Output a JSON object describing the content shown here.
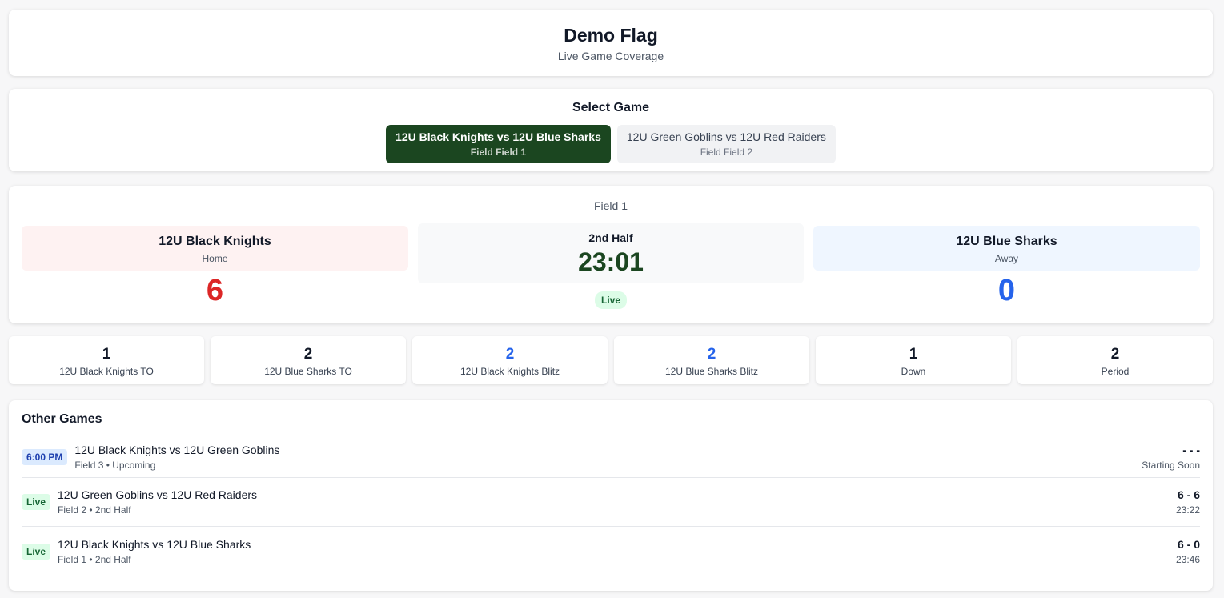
{
  "header": {
    "title": "Demo Flag",
    "subtitle": "Live Game Coverage"
  },
  "select": {
    "title": "Select Game",
    "games": [
      {
        "label": "12U Black Knights vs 12U Blue Sharks",
        "field": "Field Field 1"
      },
      {
        "label": "12U Green Goblins vs 12U Red Raiders",
        "field": "Field Field 2"
      }
    ]
  },
  "score": {
    "field": "Field 1",
    "home": {
      "name": "12U Black Knights",
      "role": "Home",
      "score": "6"
    },
    "away": {
      "name": "12U Blue Sharks",
      "role": "Away",
      "score": "0"
    },
    "period": "2nd Half",
    "clock": "23:01",
    "status": "Live"
  },
  "stats": [
    {
      "value": "1",
      "label": "12U Black Knights TO"
    },
    {
      "value": "2",
      "label": "12U Blue Sharks TO"
    },
    {
      "value": "2",
      "label": "12U Black Knights Blitz"
    },
    {
      "value": "2",
      "label": "12U Blue Sharks Blitz"
    },
    {
      "value": "1",
      "label": "Down"
    },
    {
      "value": "2",
      "label": "Period"
    }
  ],
  "other": {
    "title": "Other Games",
    "games": [
      {
        "badge": "6:00 PM",
        "title": "12U Black Knights vs 12U Green Goblins",
        "sub": "Field 3 • Upcoming",
        "score": "- - -",
        "time": "Starting Soon"
      },
      {
        "badge": "Live",
        "title": "12U Green Goblins vs 12U Red Raiders",
        "sub": "Field 2 • 2nd Half",
        "score": "6 - 6",
        "time": "23:22"
      },
      {
        "badge": "Live",
        "title": "12U Black Knights vs 12U Blue Sharks",
        "sub": "Field 1 • 2nd Half",
        "score": "6 - 0",
        "time": "23:46"
      }
    ]
  },
  "colors": {
    "accent": "#1b4620",
    "home": "#dc2626",
    "away": "#2563eb"
  }
}
